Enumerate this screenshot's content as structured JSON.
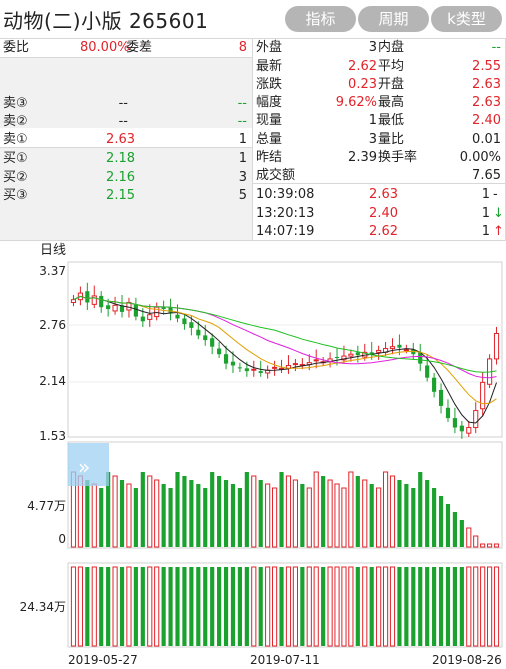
{
  "header": {
    "title": "动物(二)小版 265601",
    "buttons": [
      "指标",
      "周期",
      "k类型"
    ]
  },
  "quote": {
    "weibi_label": "委比",
    "weibi_value": "80.00%",
    "weicha_label": "委差",
    "weicha_value": "8",
    "sell": [
      {
        "label": "卖③",
        "price": "--",
        "vol": "--"
      },
      {
        "label": "卖②",
        "price": "--",
        "vol": "--"
      },
      {
        "label": "卖①",
        "price": "2.63",
        "vol": "1"
      }
    ],
    "buy": [
      {
        "label": "买①",
        "price": "2.18",
        "vol": "1"
      },
      {
        "label": "买②",
        "price": "2.16",
        "vol": "3"
      },
      {
        "label": "买③",
        "price": "2.15",
        "vol": "5"
      }
    ],
    "stats": [
      {
        "l1": "外盘",
        "v1": "3",
        "l2": "内盘",
        "v2": "--",
        "c1": "k",
        "c2": "g"
      },
      {
        "l1": "最新",
        "v1": "2.62",
        "l2": "平均",
        "v2": "2.55",
        "c1": "r",
        "c2": "r"
      },
      {
        "l1": "涨跌",
        "v1": "0.23",
        "l2": "开盘",
        "v2": "2.63",
        "c1": "r",
        "c2": "r"
      },
      {
        "l1": "幅度",
        "v1": "9.62%",
        "l2": "最高",
        "v2": "2.63",
        "c1": "r",
        "c2": "r"
      },
      {
        "l1": "现量",
        "v1": "1",
        "l2": "最低",
        "v2": "2.40",
        "c1": "k",
        "c2": "r"
      },
      {
        "l1": "总量",
        "v1": "3",
        "l2": "量比",
        "v2": "0.01",
        "c1": "k",
        "c2": "k"
      },
      {
        "l1": "昨结",
        "v1": "2.39",
        "l2": "换手率",
        "v2": "0.00%",
        "c1": "k",
        "c2": "k"
      },
      {
        "l1": "成交额",
        "v1": "",
        "l2": "",
        "v2": "7.65",
        "c1": "k",
        "c2": "k"
      }
    ],
    "ticks": [
      {
        "time": "10:39:08",
        "price": "2.63",
        "vol": "1",
        "flag": "-"
      },
      {
        "time": "13:20:13",
        "price": "2.40",
        "vol": "1",
        "flag": "↓"
      },
      {
        "time": "14:07:19",
        "price": "2.62",
        "vol": "1",
        "flag": "↑"
      }
    ]
  },
  "chart_data": {
    "type": "candlestick",
    "period_label": "日线",
    "price_ticks": [
      "3.37",
      "2.76",
      "2.14",
      "1.53"
    ],
    "ylim": [
      1.53,
      3.37
    ],
    "vol_tick": "4.77万",
    "vol_zero": "0",
    "amount_tick": "24.34万",
    "dates": [
      "2019-05-27",
      "2019-07-11",
      "2019-08-26"
    ],
    "candles_close": [
      2.98,
      3.05,
      2.95,
      3.02,
      2.9,
      2.88,
      2.92,
      2.85,
      2.95,
      2.8,
      2.75,
      2.82,
      2.9,
      2.88,
      2.84,
      2.78,
      2.72,
      2.68,
      2.6,
      2.55,
      2.48,
      2.4,
      2.3,
      2.28,
      2.25,
      2.22,
      2.24,
      2.2,
      2.23,
      2.26,
      2.25,
      2.28,
      2.3,
      2.29,
      2.31,
      2.34,
      2.32,
      2.35,
      2.36,
      2.38,
      2.4,
      2.39,
      2.42,
      2.4,
      2.44,
      2.46,
      2.48,
      2.47,
      2.45,
      2.4,
      2.3,
      2.15,
      2.0,
      1.85,
      1.72,
      1.62,
      1.58,
      1.62,
      1.8,
      2.1,
      2.35,
      2.62
    ],
    "ma_colors": [
      "#222222",
      "#e0a000",
      "#e020e0",
      "#20c020"
    ],
    "up_color": "#e0242a",
    "down_color": "#1aa12e"
  }
}
